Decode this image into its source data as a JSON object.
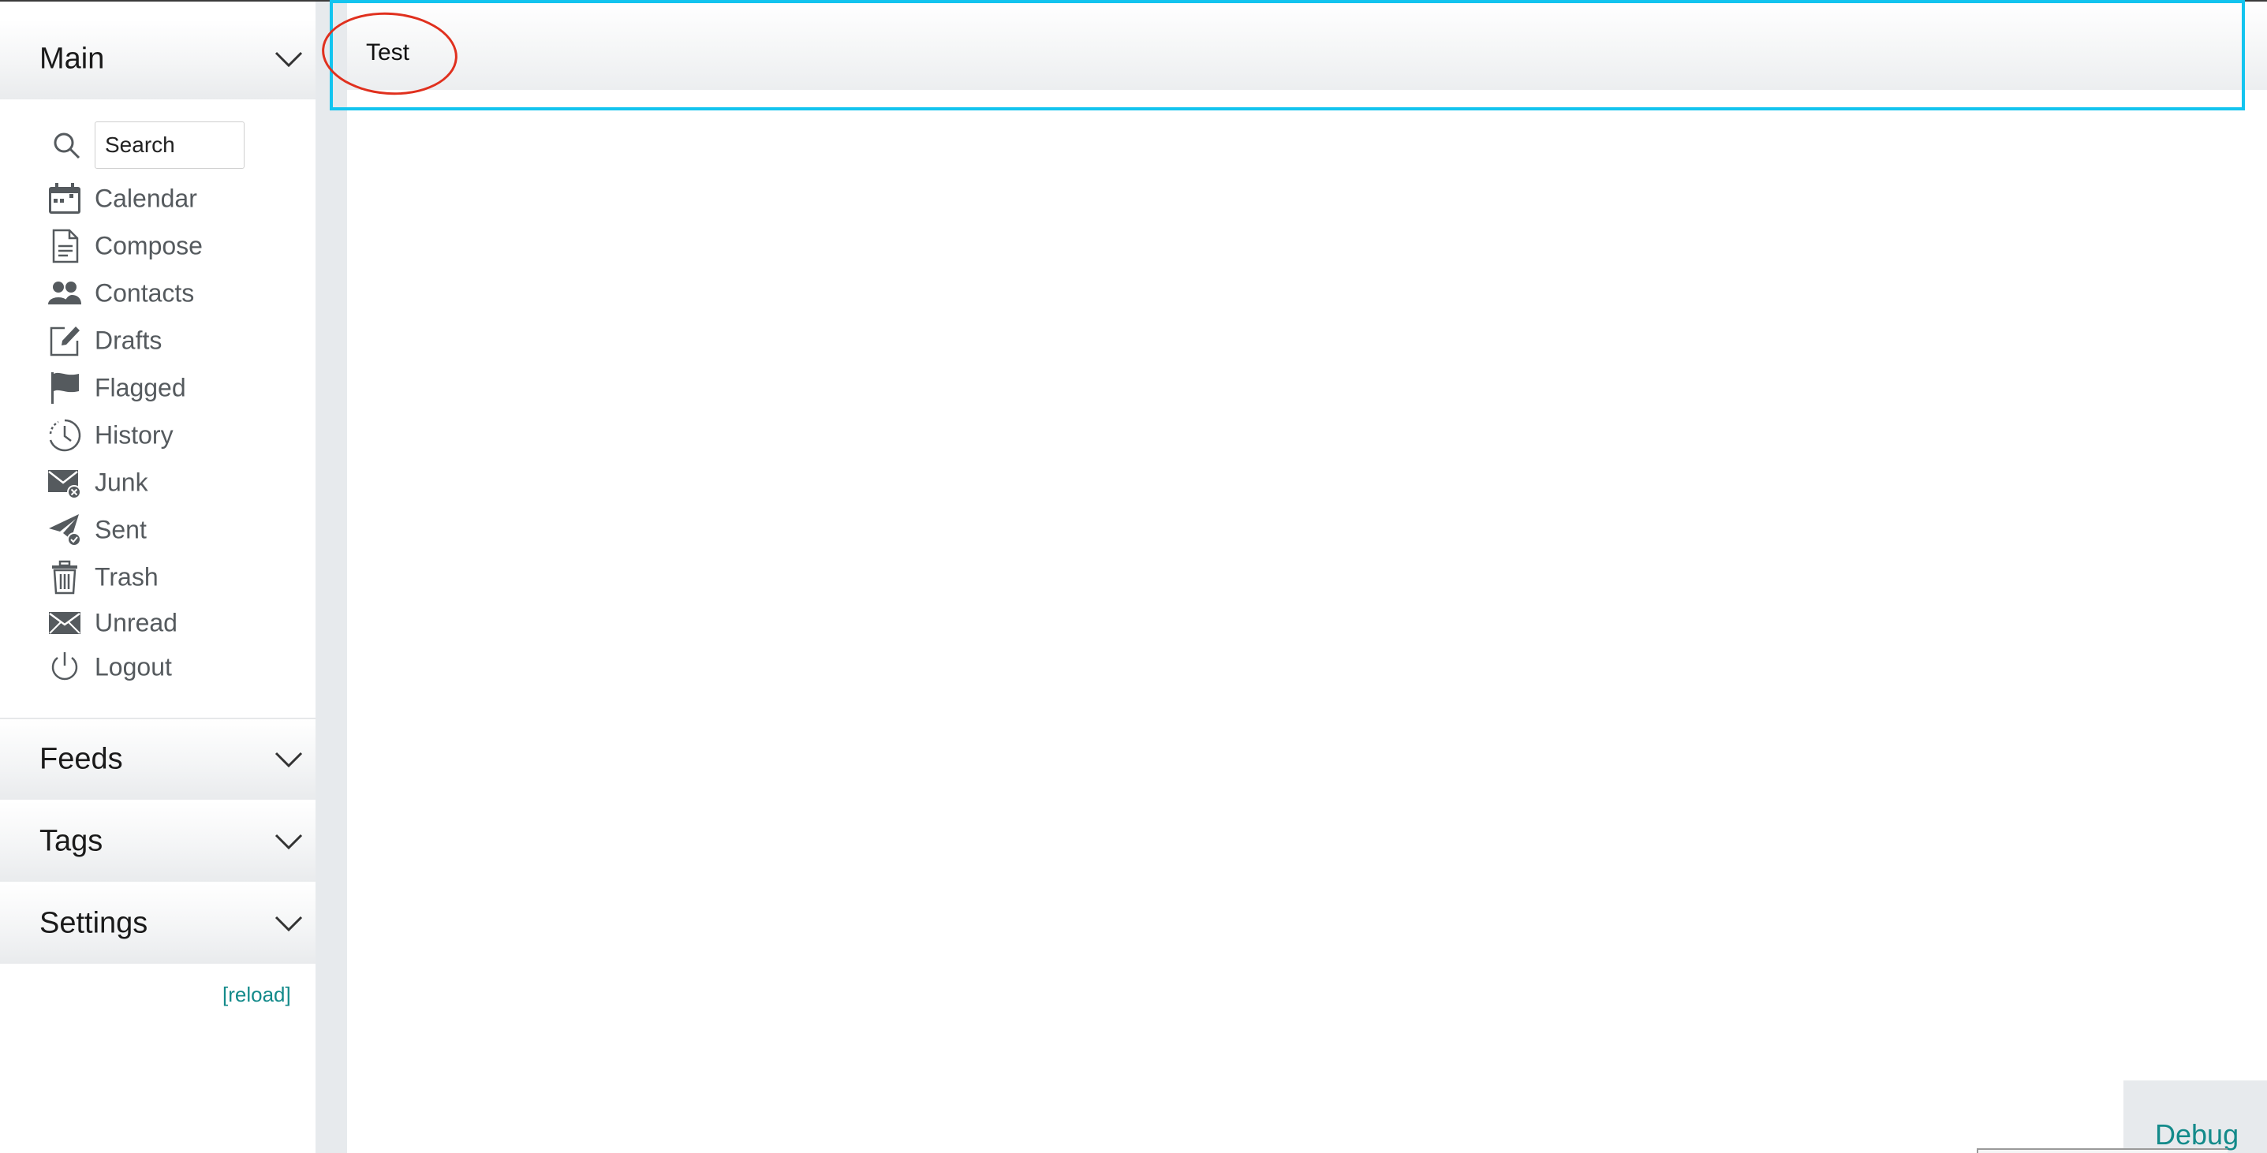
{
  "sidebar": {
    "sections": [
      {
        "title": "Main"
      },
      {
        "title": "Feeds"
      },
      {
        "title": "Tags"
      },
      {
        "title": "Settings"
      }
    ],
    "search": {
      "placeholder": "Search"
    },
    "menu_items": [
      {
        "label": "Calendar",
        "icon": "calendar-icon"
      },
      {
        "label": "Compose",
        "icon": "document-icon"
      },
      {
        "label": "Contacts",
        "icon": "people-icon"
      },
      {
        "label": "Drafts",
        "icon": "edit-icon"
      },
      {
        "label": "Flagged",
        "icon": "flag-icon"
      },
      {
        "label": "History",
        "icon": "clock-icon"
      },
      {
        "label": "Junk",
        "icon": "envelope-x-icon"
      },
      {
        "label": "Sent",
        "icon": "send-check-icon"
      },
      {
        "label": "Trash",
        "icon": "trash-icon"
      },
      {
        "label": "Unread",
        "icon": "envelope-icon"
      },
      {
        "label": "Logout",
        "icon": "power-icon"
      }
    ],
    "reload_label": "[reload]"
  },
  "content": {
    "title": "Test"
  },
  "debug": {
    "label": "Debug"
  },
  "colors": {
    "accent_link": "#138a8a",
    "highlight_box": "#13c4ef",
    "circle_annotation": "#e0301e",
    "icon_gray": "#555a5e"
  }
}
